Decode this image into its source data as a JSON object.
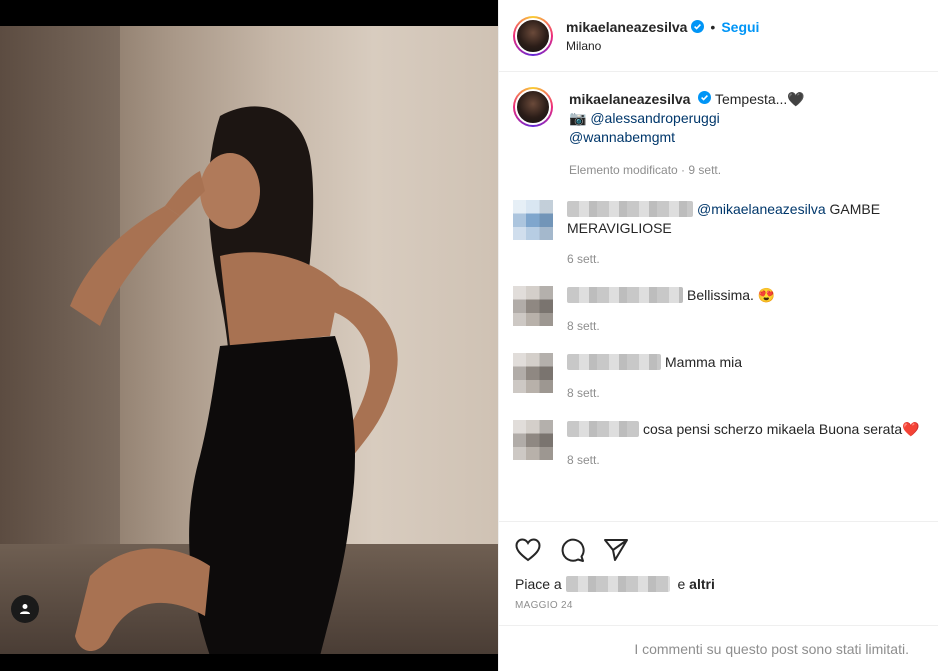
{
  "post": {
    "username": "mikaelaneazesilva",
    "location": "Milano",
    "follow_label": "Segui",
    "dot": "•"
  },
  "caption": {
    "text": "Tempesta...🖤",
    "camera": "📷",
    "mention1": "@alessandroperuggi",
    "mention2": "@wannabemgmt",
    "meta": "Elemento modificato · 9 sett."
  },
  "comments": [
    {
      "mention": "@mikaelaneazesilva",
      "text": " GAMBE MERAVIGLIOSE",
      "time": "6 sett."
    },
    {
      "text": "Bellissima. 😍",
      "time": "8 sett."
    },
    {
      "text": "Mamma mia",
      "time": "8 sett."
    },
    {
      "text": "cosa pensi scherzo mikaela Buona serata❤️",
      "time": "8 sett."
    }
  ],
  "likes": {
    "prefix": "Piace a",
    "and": "e",
    "others": "altri"
  },
  "date": "MAGGIO 24",
  "limited_notice": "I commenti su questo post sono stati limitati.",
  "colors": {
    "accent": "#0095f6",
    "mention": "#00376b",
    "secondary_text": "#8e8e8e",
    "verified": "#0095f6"
  },
  "icons": [
    "heart-icon",
    "comment-icon",
    "share-icon",
    "verified-icon",
    "user-tag-icon"
  ]
}
